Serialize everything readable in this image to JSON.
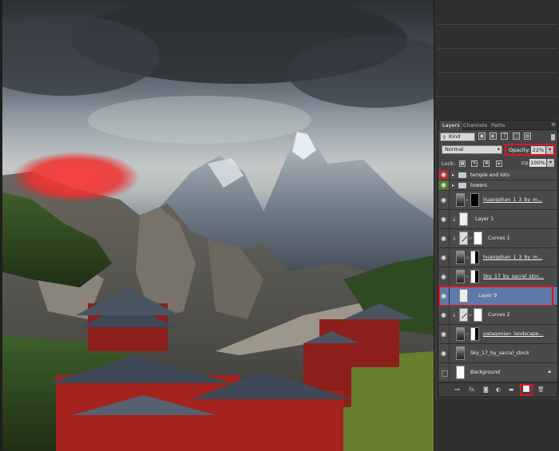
{
  "layers_panel": {
    "tabs": [
      {
        "label": "Layers",
        "active": true
      },
      {
        "label": "Channels",
        "active": false
      },
      {
        "label": "Paths",
        "active": false
      }
    ],
    "menu_icon": "panel-menu-icon",
    "filter_kind": "Kind",
    "blend_mode": "Normal",
    "opacity_label": "Opacity:",
    "opacity_value": "22%",
    "lock_label": "Lock:",
    "fill_label": "Fill:",
    "fill_value": "100%",
    "layers": [
      {
        "name": "temple and loto",
        "type": "group",
        "eye_color": "red"
      },
      {
        "name": "towers",
        "type": "group",
        "eye_color": "green"
      },
      {
        "name": "huangshan_1_3_by_m...",
        "type": "image-mask"
      },
      {
        "name": "Layer 1",
        "type": "layer"
      },
      {
        "name": "Curves 1",
        "type": "adjustment"
      },
      {
        "name": "huangshan_1_3_by_m...",
        "type": "image-mask"
      },
      {
        "name": "Sky_17_by_sacral_stoc...",
        "type": "image-mask"
      },
      {
        "name": "Layer 9",
        "type": "layer",
        "selected": true
      },
      {
        "name": "Curves 2",
        "type": "adjustment"
      },
      {
        "name": "patagonian_landscape...",
        "type": "image-mask"
      },
      {
        "name": "Sky_17_by_sacral_stock",
        "type": "image"
      },
      {
        "name": "Background",
        "type": "background",
        "locked": true
      }
    ],
    "bottom_icons": [
      "link-icon",
      "fx-icon",
      "mask-icon",
      "adjustment-icon",
      "folder-icon",
      "new-layer-icon",
      "trash-icon"
    ]
  },
  "colors": {
    "highlight_red": "#e0141e",
    "selection_blue": "#5f7aa8",
    "panel_bg": "#454545"
  }
}
